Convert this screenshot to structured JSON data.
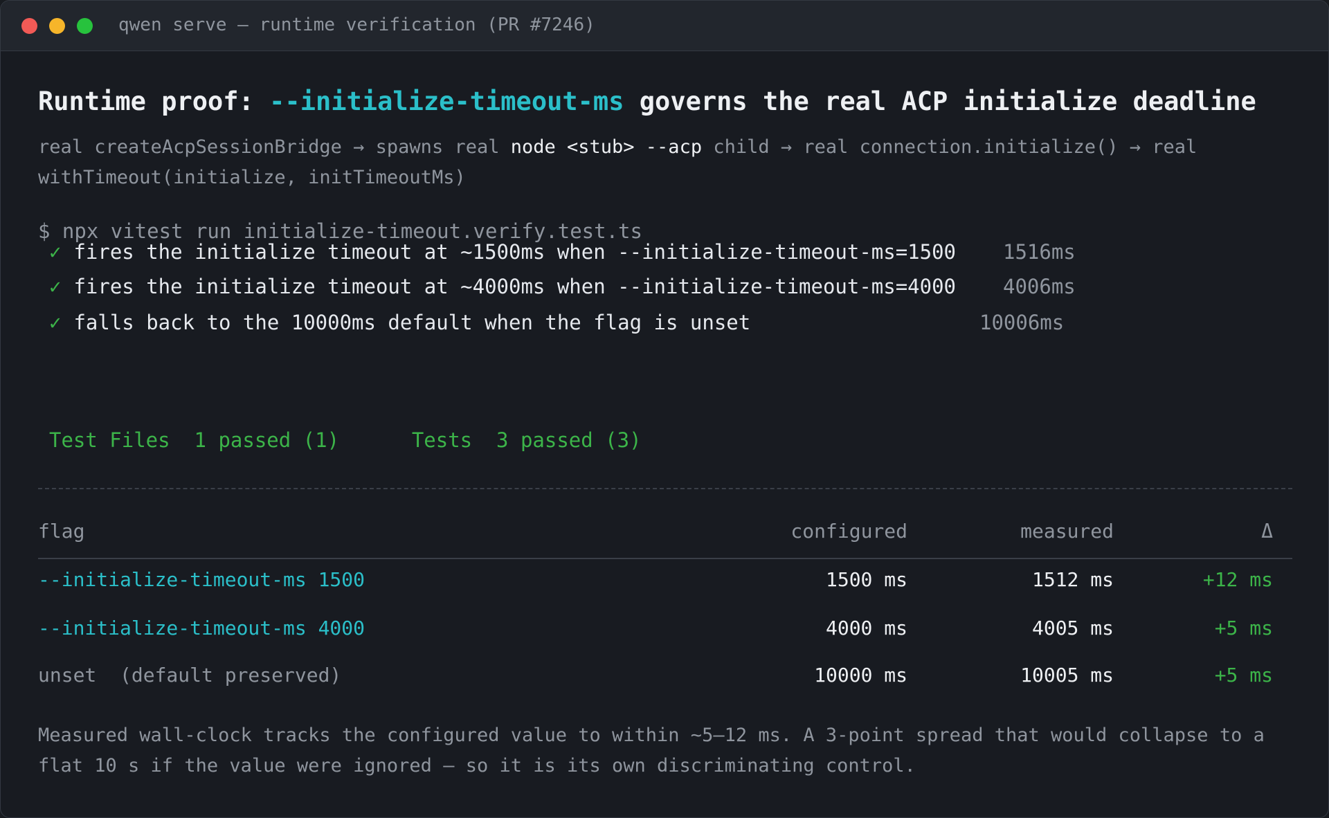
{
  "window": {
    "title": "qwen serve — runtime verification (PR #7246)"
  },
  "headline": {
    "prefix": "Runtime proof: ",
    "flag": "--initialize-timeout-ms",
    "suffix": " governs the real ACP initialize deadline"
  },
  "description": {
    "part1": "real createAcpSessionBridge → spawns real ",
    "highlight": "node <stub> --acp",
    "part2": " child → real connection.initialize() → real withTimeout(initialize, initTimeoutMs)"
  },
  "command": "$ npx vitest run initialize-timeout.verify.test.ts",
  "tests": [
    {
      "check": "✓",
      "name": "fires the initialize timeout at ~1500ms when --initialize-timeout-ms=1500",
      "duration": "1516ms"
    },
    {
      "check": "✓",
      "name": "fires the initialize timeout at ~4000ms when --initialize-timeout-ms=4000",
      "duration": "4006ms"
    },
    {
      "check": "✓",
      "name": "falls back to the 10000ms default when the flag is unset",
      "duration": "10006ms"
    }
  ],
  "summary": {
    "files_label": "Test Files",
    "files_value": "1 passed (1)",
    "tests_label": "Tests",
    "tests_value": "3 passed (3)"
  },
  "table": {
    "headers": {
      "flag": "flag",
      "configured": "configured",
      "measured": "measured",
      "delta": "Δ"
    },
    "rows": [
      {
        "flag": "--initialize-timeout-ms 1500",
        "configured": "1500 ms",
        "measured": "1512 ms",
        "delta": "+12 ms"
      },
      {
        "flag": "--initialize-timeout-ms 4000",
        "configured": "4000 ms",
        "measured": "4005 ms",
        "delta": "+5 ms"
      },
      {
        "flag": "unset  (default preserved)",
        "configured": "10000 ms",
        "measured": "10005 ms",
        "delta": "+5 ms"
      }
    ]
  },
  "footnote": "Measured wall-clock tracks the configured value to within ~5–12 ms. A 3-point spread that would collapse to a flat 10 s if the value were ignored — so it is its own discriminating control.",
  "colors": {
    "accent_cyan": "#2bbfc9",
    "pass_green": "#3cb449",
    "muted_text": "#8f959e",
    "background": "#181b21"
  }
}
